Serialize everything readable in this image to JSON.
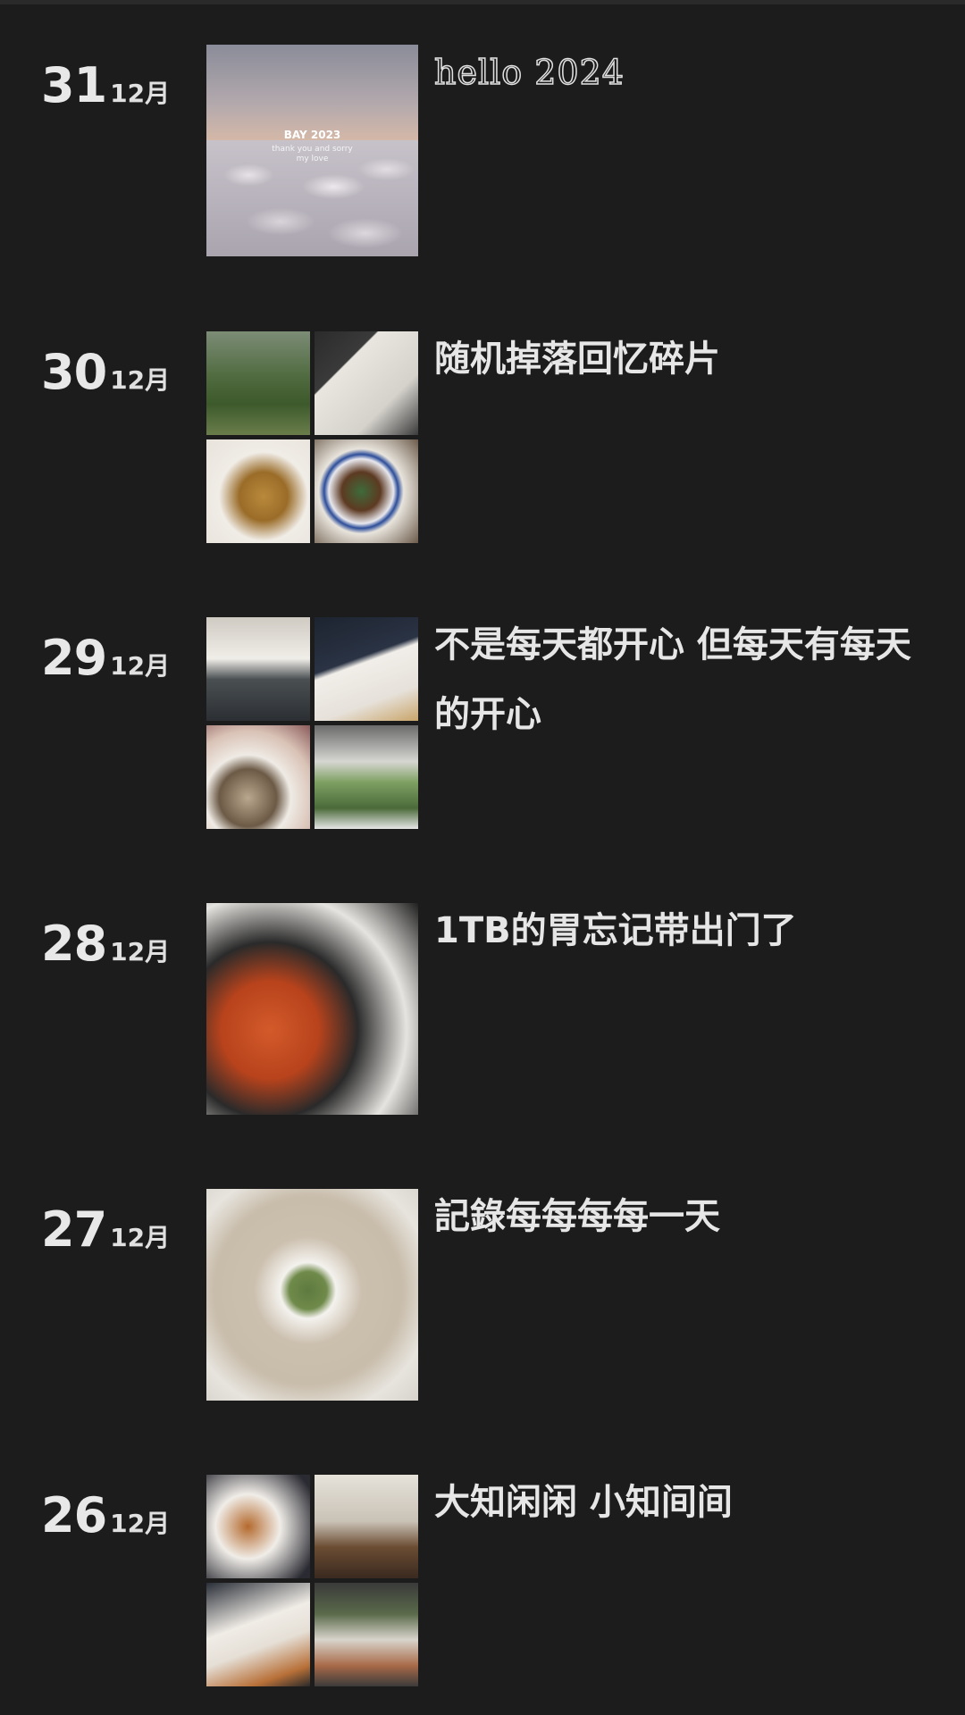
{
  "entries": [
    {
      "day": "31",
      "month": "12月",
      "caption": "hello 2024",
      "photo_text": {
        "title": "BAY 2023",
        "subtitle": "thank you and sorry\nmy love"
      }
    },
    {
      "day": "30",
      "month": "12月",
      "caption": "随机掉落回忆碎片"
    },
    {
      "day": "29",
      "month": "12月",
      "caption": "不是每天都开心 但每天有每天的开心"
    },
    {
      "day": "28",
      "month": "12月",
      "caption": "1TB的胃忘记带出门了"
    },
    {
      "day": "27",
      "month": "12月",
      "caption": "記錄每每每每一天"
    },
    {
      "day": "26",
      "month": "12月",
      "caption": "大知闲闲 小知间间"
    }
  ]
}
